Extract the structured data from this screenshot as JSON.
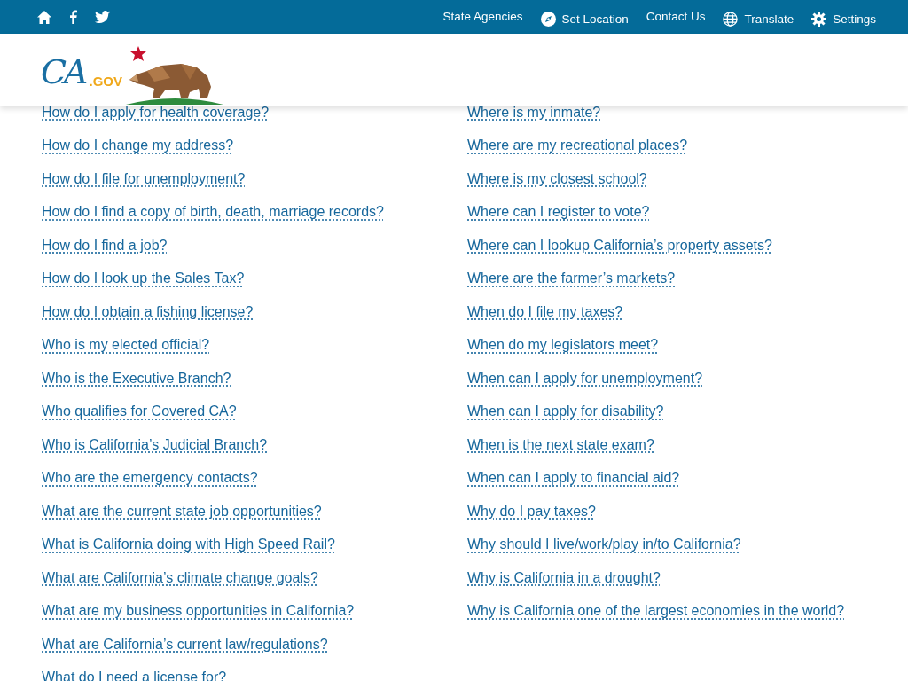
{
  "top_bar": {
    "social": [
      {
        "kind": "home"
      },
      {
        "kind": "facebook"
      },
      {
        "kind": "twitter"
      }
    ],
    "links": [
      {
        "label": "State Agencies",
        "kind": "none"
      },
      {
        "label": "Set Location",
        "kind": "location"
      },
      {
        "label": "Contact Us",
        "kind": "none"
      },
      {
        "label": "Translate",
        "kind": "globe"
      },
      {
        "label": "Settings",
        "kind": "gear"
      }
    ]
  },
  "logo": {
    "ca": "CA",
    "gov": ".GOV"
  },
  "questions_left": [
    "How do I apply for health coverage?",
    "How do I change my address?",
    "How do I file for unemployment?",
    "How do I find a copy of birth, death, marriage records?",
    "How do I find a job?",
    "How do I look up the Sales Tax?",
    "How do I obtain a fishing license?",
    "Who is my elected official?",
    "Who is the Executive Branch?",
    "Who qualifies for Covered CA?",
    "Who is California’s Judicial Branch?",
    "Who are the emergency contacts?",
    "What are the current state job opportunities?",
    "What is California doing with High Speed Rail?",
    "What are California’s climate change goals?",
    "What are my business opportunities in California?",
    "What are California’s current law/regulations?",
    "What do I need a license for?"
  ],
  "questions_right": [
    "Where is my inmate?",
    "Where are my recreational places?",
    "Where is my closest school?",
    "Where can I register to vote?",
    "Where can I lookup California’s property assets?",
    "Where are the farmer’s markets?",
    "When do I file my taxes?",
    "When do my legislators meet?",
    "When can I apply for unemployment?",
    "When can I apply for disability?",
    "When is the next state exam?",
    "When can I apply to financial aid?",
    "Why do I pay taxes?",
    "Why should I live/work/play in/to California?",
    "Why is California in a drought?",
    "Why is California one of the largest economies in the world?"
  ]
}
